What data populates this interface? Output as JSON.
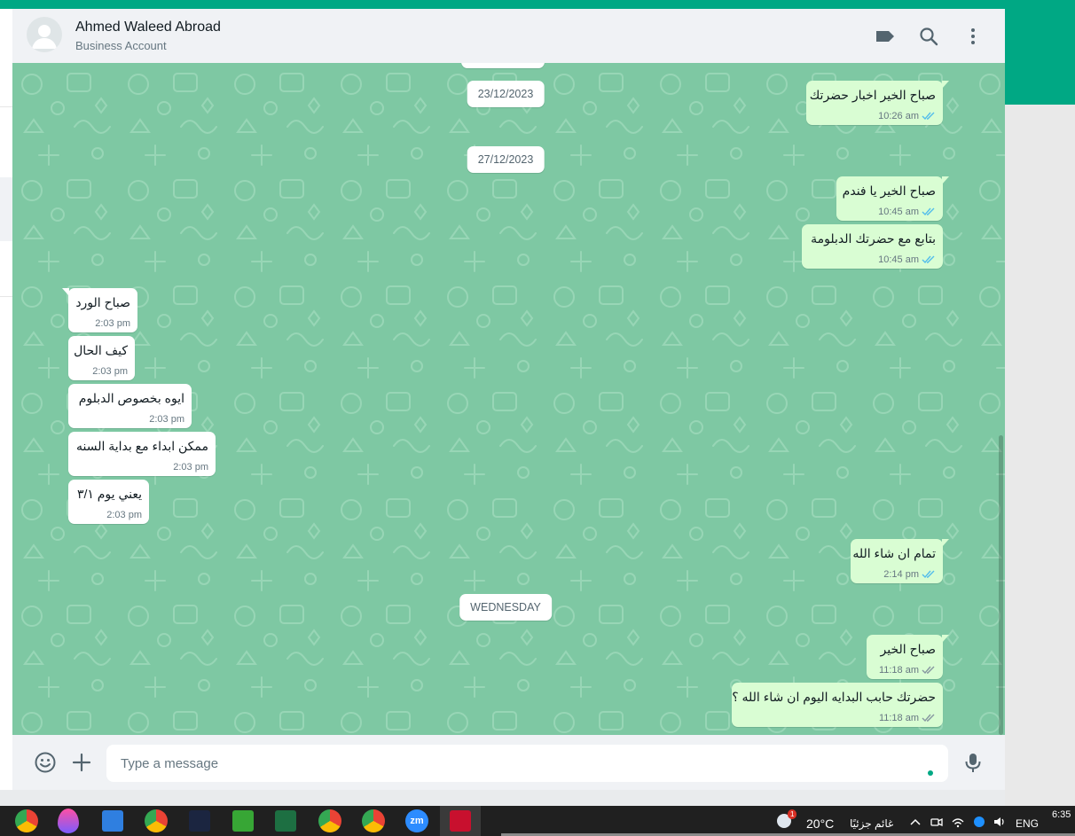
{
  "header": {
    "contact_name": "Ahmed Waleed Abroad",
    "contact_subtitle": "Business Account",
    "icons": [
      "label-icon",
      "search-icon",
      "menu-icon"
    ]
  },
  "colors": {
    "accent": "#00a884",
    "wallpaper": "#7ec8a3",
    "bubble_out": "#d9fdd3",
    "bubble_in": "#ffffff",
    "read_ticks": "#53bdeb",
    "sent_ticks": "#8696a0"
  },
  "dates": [
    "23/12/2023",
    "27/12/2023",
    "WEDNESDAY"
  ],
  "messages": [
    {
      "dir": "out",
      "text": "صباح الخير اخبار حضرتك",
      "time": "10:26 am",
      "status": "read"
    },
    {
      "dir": "out",
      "text": "صباح الخير يا فندم",
      "time": "10:45 am",
      "status": "read"
    },
    {
      "dir": "out",
      "text": "بتابع مع حضرتك الدبلومة",
      "time": "10:45 am",
      "status": "read"
    },
    {
      "dir": "in",
      "text": "صباح الورد",
      "time": "2:03 pm"
    },
    {
      "dir": "in",
      "text": "كيف الحال",
      "time": "2:03 pm"
    },
    {
      "dir": "in",
      "text": "ايوه بخصوص الدبلوم",
      "time": "2:03 pm"
    },
    {
      "dir": "in",
      "text": "ممكن ابداء مع بداية السنه",
      "time": "2:03 pm"
    },
    {
      "dir": "in",
      "text": "يعني يوم ٣/١",
      "time": "2:03 pm"
    },
    {
      "dir": "out",
      "text": "تمام ان شاء الله",
      "time": "2:14 pm",
      "status": "read"
    },
    {
      "dir": "out",
      "text": "صباح الخير",
      "time": "11:18 am",
      "status": "delivered"
    },
    {
      "dir": "out",
      "text": "حضرتك حابب البدايه اليوم ان شاء الله ؟",
      "time": "11:18 am",
      "status": "delivered"
    }
  ],
  "composer": {
    "placeholder": "Type a message",
    "icons": [
      "emoji-icon",
      "attach-plus-icon",
      "microphone-icon"
    ]
  },
  "taskbar": {
    "apps": [
      "chrome-icon",
      "paint-drop-icon",
      "photos-icon",
      "chrome-profile-icon",
      "app-diamond-icon",
      "camtasia-icon",
      "excel-icon",
      "chrome-profile-icon",
      "chrome-profile-icon",
      "zoom-icon",
      "acrobat-icon"
    ],
    "zoom_label": "zm",
    "weather_badge": "1",
    "temperature": "20°C",
    "weather_text": "غائم جزئيًا",
    "language": "ENG",
    "time": "6:35"
  }
}
